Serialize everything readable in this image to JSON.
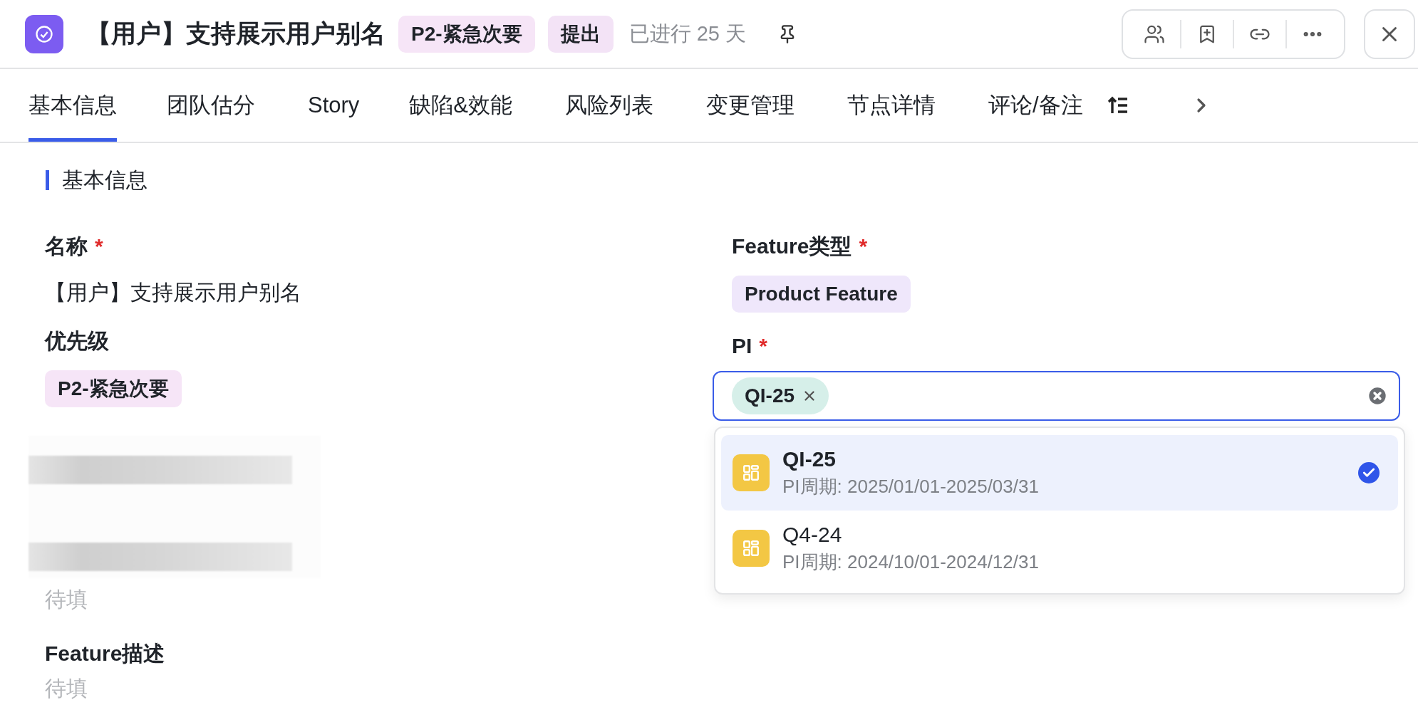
{
  "header": {
    "title": "【用户】支持展示用户别名",
    "tags": [
      {
        "label": "P2-紧急次要",
        "color": "#f6e5f7"
      },
      {
        "label": "提出",
        "color": "#f3e3f6"
      }
    ],
    "elapsed": "已进行 25 天"
  },
  "tabs": [
    {
      "label": "基本信息",
      "selected": true
    },
    {
      "label": "团队估分",
      "selected": false
    },
    {
      "label": "Story",
      "selected": false
    },
    {
      "label": "缺陷&效能",
      "selected": false
    },
    {
      "label": "风险列表",
      "selected": false
    },
    {
      "label": "变更管理",
      "selected": false
    },
    {
      "label": "节点详情",
      "selected": false
    },
    {
      "label": "评论/备注",
      "selected": false
    }
  ],
  "section": {
    "title": "基本信息"
  },
  "required_mark": "*",
  "left_fields": [
    {
      "kind": "text",
      "label": "名称",
      "required": true,
      "value": "【用户】支持展示用户别名"
    },
    {
      "kind": "tag",
      "label": "优先级",
      "required": false,
      "value": "P2-紧急次要",
      "color": "#f6e5f7"
    },
    {
      "kind": "redacted"
    },
    {
      "kind": "empty",
      "placeholder": "待填"
    },
    {
      "kind": "empty",
      "label": "Feature描述",
      "required": false,
      "placeholder": "待填"
    }
  ],
  "right_fields": [
    {
      "kind": "tag",
      "label": "Feature类型",
      "required": true,
      "value": "Product Feature",
      "color": "#efe7fb"
    },
    {
      "kind": "select",
      "label": "PI",
      "required": true,
      "chips": [
        {
          "label": "QI-25",
          "color": "#d6efe9"
        }
      ],
      "options": [
        {
          "title": "QI-25",
          "period": "PI周期: 2025/01/01-2025/03/31",
          "selected": true
        },
        {
          "title": "Q4-24",
          "period": "PI周期: 2024/10/01-2024/12/31",
          "selected": false
        }
      ]
    }
  ]
}
